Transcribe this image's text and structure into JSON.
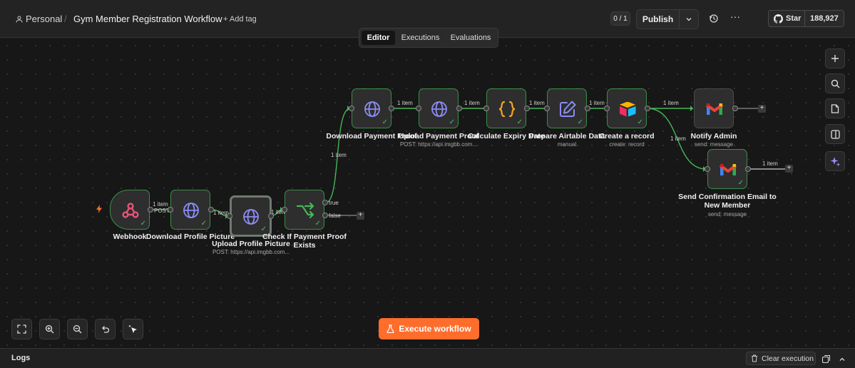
{
  "header": {
    "workspace": "Personal",
    "workflow_name": "Gym Member Registration Workflow",
    "add_tag": "+ Add tag",
    "version_counter": "0 / 1",
    "publish_label": "Publish",
    "star_label": "Star",
    "star_count": "188,927"
  },
  "tabs": [
    {
      "label": "Editor",
      "active": true
    },
    {
      "label": "Executions",
      "active": false
    },
    {
      "label": "Evaluations",
      "active": false
    }
  ],
  "nodes": {
    "webhook": {
      "label": "Webhook",
      "icon": "webhook-icon"
    },
    "download_profile": {
      "label": "Download Profile Picture",
      "icon": "globe-icon"
    },
    "upload_profile": {
      "label": "Upload Profile Picture",
      "sub": "POST: https://api.imgbb.com...",
      "icon": "globe-icon"
    },
    "check_payment": {
      "label": "Check If Payment Proof Exists",
      "icon": "if-branch-icon"
    },
    "download_payment": {
      "label": "Download Payment Proof",
      "icon": "globe-icon"
    },
    "upload_payment": {
      "label": "Upload Payment Proof",
      "sub": "POST: https://api.imgbb.com...",
      "icon": "globe-icon"
    },
    "calculate_expiry": {
      "label": "Calculate Expiry Date",
      "icon": "code-braces-icon"
    },
    "prepare_airtable": {
      "label": "Prepare Airtable Data",
      "sub": "manual",
      "icon": "edit-icon"
    },
    "create_record": {
      "label": "Create a record",
      "sub": "create: record",
      "icon": "airtable-icon"
    },
    "notify_admin": {
      "label": "Notify Admin",
      "sub": "send: message",
      "icon": "gmail-icon"
    },
    "send_confirmation": {
      "label": "Send Confirmation Email to New Member",
      "sub": "send: message",
      "icon": "gmail-icon"
    }
  },
  "edges": {
    "one_item": "1 item",
    "post": "POST",
    "true_label": "true",
    "false_label": "false"
  },
  "execute_label": "Execute workflow",
  "logs": {
    "title": "Logs",
    "clear_label": "Clear execution"
  },
  "colors": {
    "accent_orange": "#ff6d2d",
    "success_green": "#4cc163",
    "globe_purple": "#8b8cf5",
    "webhook_pink": "#e5547a"
  }
}
